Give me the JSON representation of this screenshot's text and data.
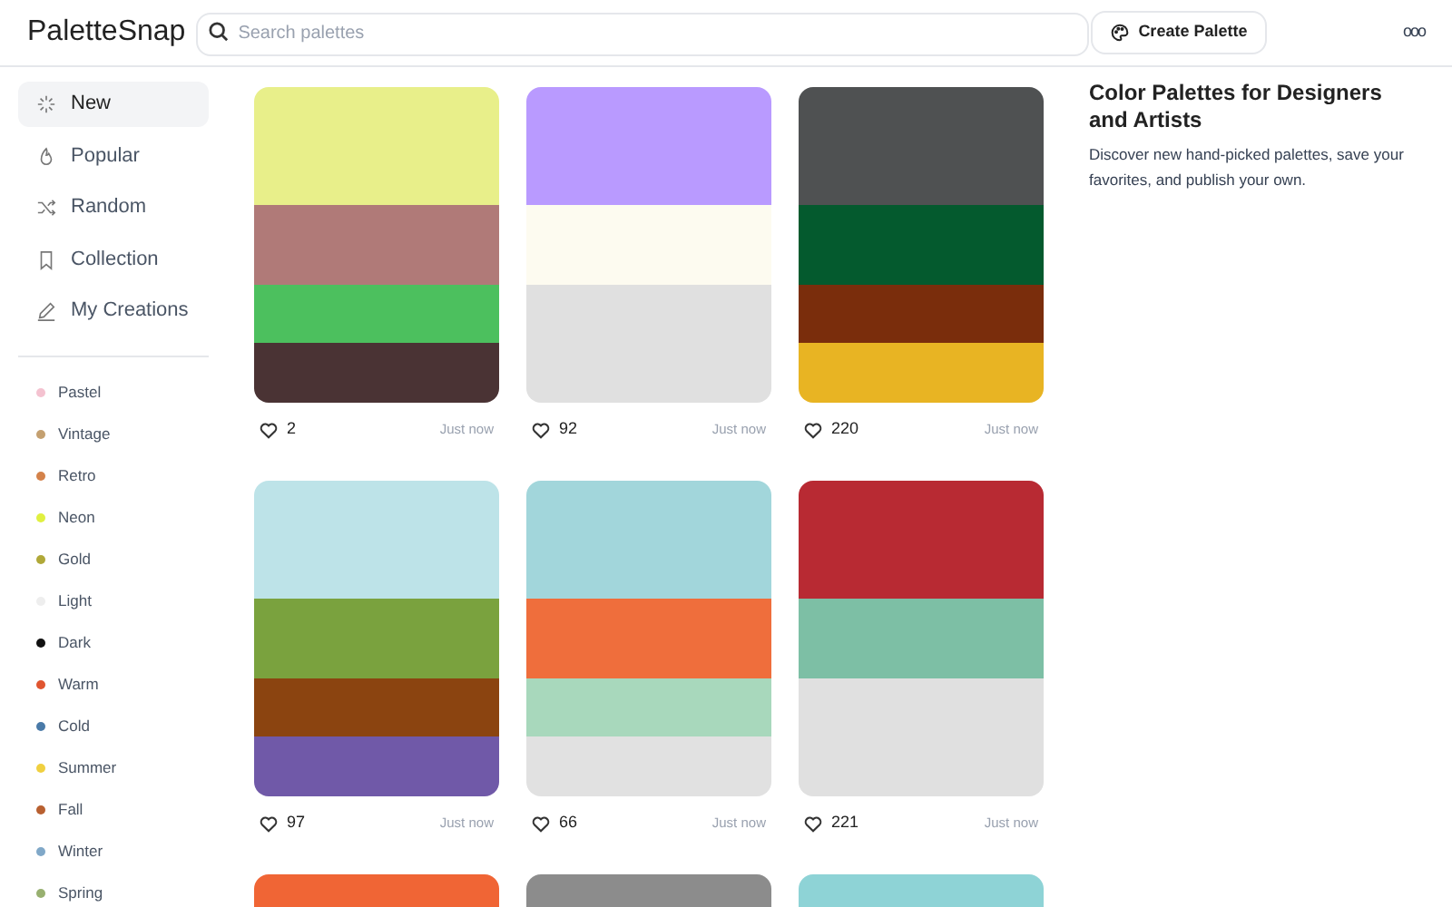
{
  "header": {
    "logo": "PaletteSnap",
    "search": {
      "placeholder": "Search palettes"
    },
    "create_button": "Create Palette",
    "more_button": "ooo"
  },
  "sidebar": {
    "nav": [
      {
        "label": "New",
        "selected": true
      },
      {
        "label": "Popular",
        "selected": false
      },
      {
        "label": "Random",
        "selected": false
      },
      {
        "label": "Collection",
        "selected": false
      },
      {
        "label": "My Creations",
        "selected": false
      }
    ],
    "categories": [
      {
        "label": "Pastel",
        "color": "#f4c2d0"
      },
      {
        "label": "Vintage",
        "color": "#c4a070"
      },
      {
        "label": "Retro",
        "color": "#d4824a"
      },
      {
        "label": "Neon",
        "color": "#e0f040"
      },
      {
        "label": "Gold",
        "color": "#b0a838"
      },
      {
        "label": "Light",
        "color": "#eeeeee"
      },
      {
        "label": "Dark",
        "color": "#111111"
      },
      {
        "label": "Warm",
        "color": "#e05530"
      },
      {
        "label": "Cold",
        "color": "#4a7aa8"
      },
      {
        "label": "Summer",
        "color": "#f0d040"
      },
      {
        "label": "Fall",
        "color": "#b86030"
      },
      {
        "label": "Winter",
        "color": "#80a8c8"
      },
      {
        "label": "Spring",
        "color": "#98b070"
      }
    ]
  },
  "palettes": [
    {
      "swatches": [
        {
          "color": "#e8ef8a"
        },
        {
          "color": "#b07a78"
        },
        {
          "color": "#4cc05e"
        },
        {
          "color": "#4a3334"
        }
      ],
      "likes": "2",
      "time": "Just now"
    },
    {
      "swatches": [
        {
          "color": "#b99aff"
        },
        {
          "color": "#fdfbf0"
        },
        {
          "color": "#e0e0e0"
        }
      ],
      "likes": "92",
      "time": "Just now"
    },
    {
      "swatches": [
        {
          "color": "#4f5152"
        },
        {
          "color": "#045a2e"
        },
        {
          "color": "#7a2d0c"
        },
        {
          "color": "#e8b423"
        }
      ],
      "likes": "220",
      "time": "Just now"
    },
    {
      "swatches": [
        {
          "color": "#bde3e8"
        },
        {
          "color": "#7aa23e"
        },
        {
          "color": "#8b4410"
        },
        {
          "color": "#7059a8"
        }
      ],
      "likes": "97",
      "time": "Just now"
    },
    {
      "swatches": [
        {
          "color": "#a2d6db"
        },
        {
          "color": "#ef6e3c"
        },
        {
          "color": "#a8d8bc"
        },
        {
          "color": "#e1e1e1"
        }
      ],
      "likes": "66",
      "time": "Just now"
    },
    {
      "swatches": [
        {
          "color": "#b82a33"
        },
        {
          "color": "#7dbfa5"
        },
        {
          "color": "#e0e0e0"
        }
      ],
      "likes": "221",
      "time": "Just now"
    },
    {
      "swatches": [
        {
          "color": "#f06535"
        }
      ]
    },
    {
      "swatches": [
        {
          "color": "#8c8c8c"
        }
      ]
    },
    {
      "swatches": [
        {
          "color": "#8ed3d6"
        }
      ]
    }
  ],
  "info": {
    "title": "Color Palettes for Designers and Artists",
    "text": "Discover new hand-picked palettes, save your favorites, and publish your own."
  }
}
